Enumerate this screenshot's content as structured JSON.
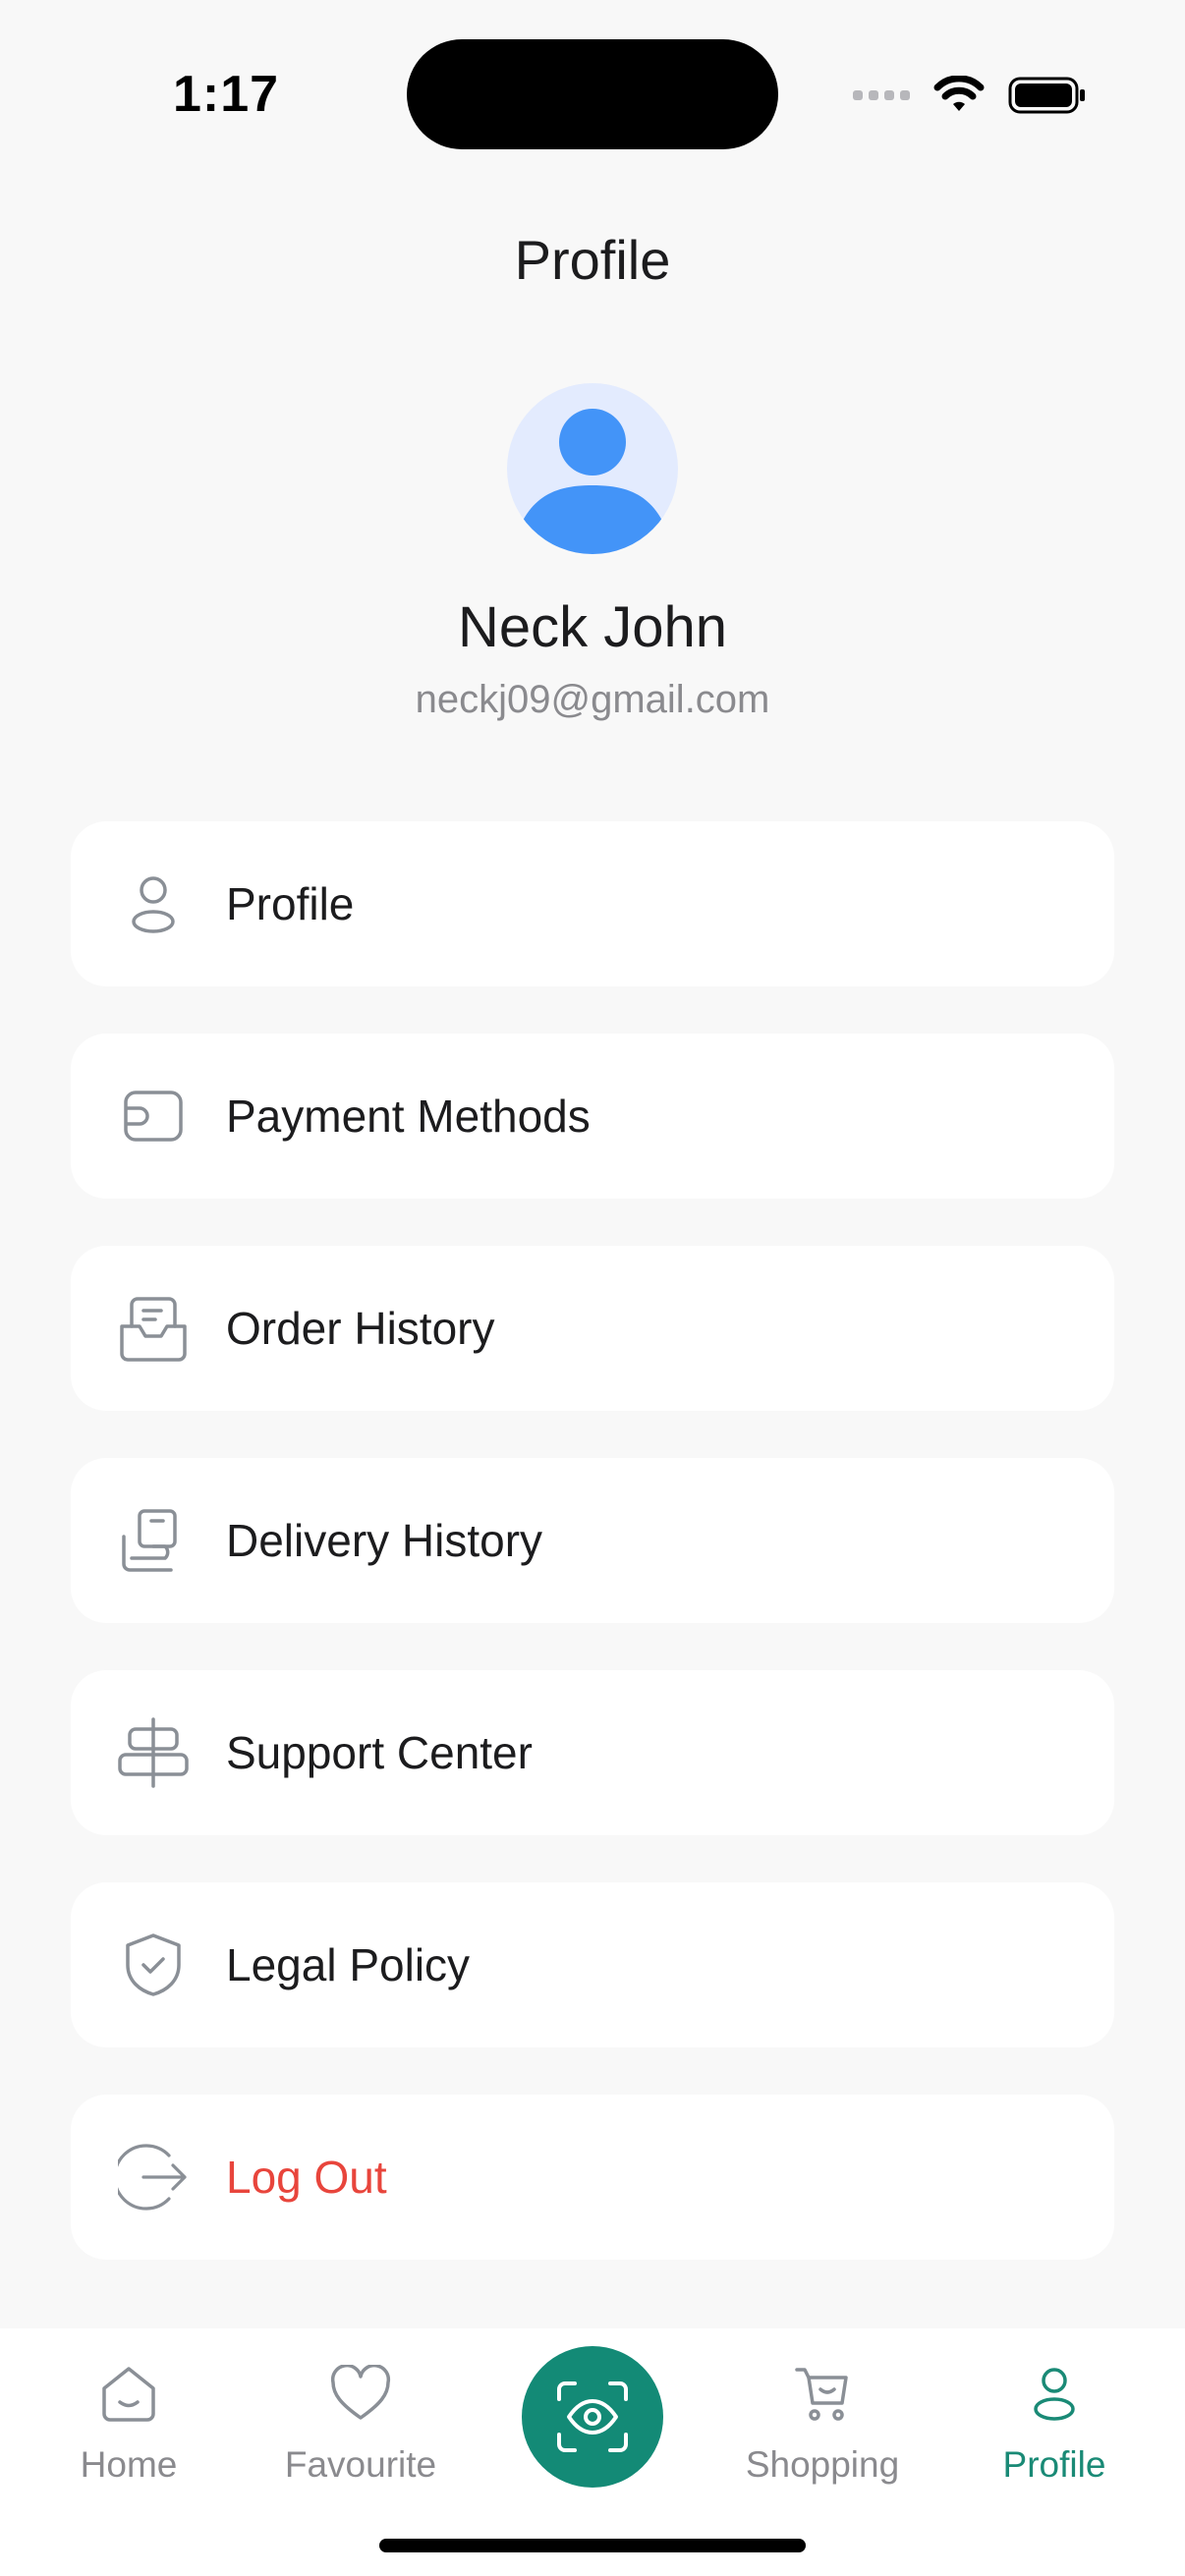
{
  "status_bar": {
    "time": "1:17"
  },
  "header": {
    "title": "Profile"
  },
  "user": {
    "name": "Neck John",
    "email": "neckj09@gmail.com"
  },
  "menu": [
    {
      "label": "Profile",
      "icon": "person-icon"
    },
    {
      "label": "Payment Methods",
      "icon": "wallet-icon"
    },
    {
      "label": "Order History",
      "icon": "inbox-icon"
    },
    {
      "label": "Delivery History",
      "icon": "package-icon"
    },
    {
      "label": "Support Center",
      "icon": "signpost-icon"
    },
    {
      "label": "Legal Policy",
      "icon": "shield-check-icon"
    },
    {
      "label": "Log Out",
      "icon": "logout-icon"
    }
  ],
  "tabbar": {
    "tabs": [
      {
        "label": "Home",
        "icon": "home-icon"
      },
      {
        "label": "Favourite",
        "icon": "heart-icon"
      },
      {
        "label": "",
        "icon": "scan-eye-icon"
      },
      {
        "label": "Shopping",
        "icon": "cart-icon"
      },
      {
        "label": "Profile",
        "icon": "person-icon",
        "active": true
      }
    ]
  },
  "colors": {
    "accent": "#138a76",
    "danger": "#e8453c",
    "avatar_bg": "#e3ebfe",
    "avatar_fg": "#4394f8",
    "background": "#f8f8f8"
  }
}
